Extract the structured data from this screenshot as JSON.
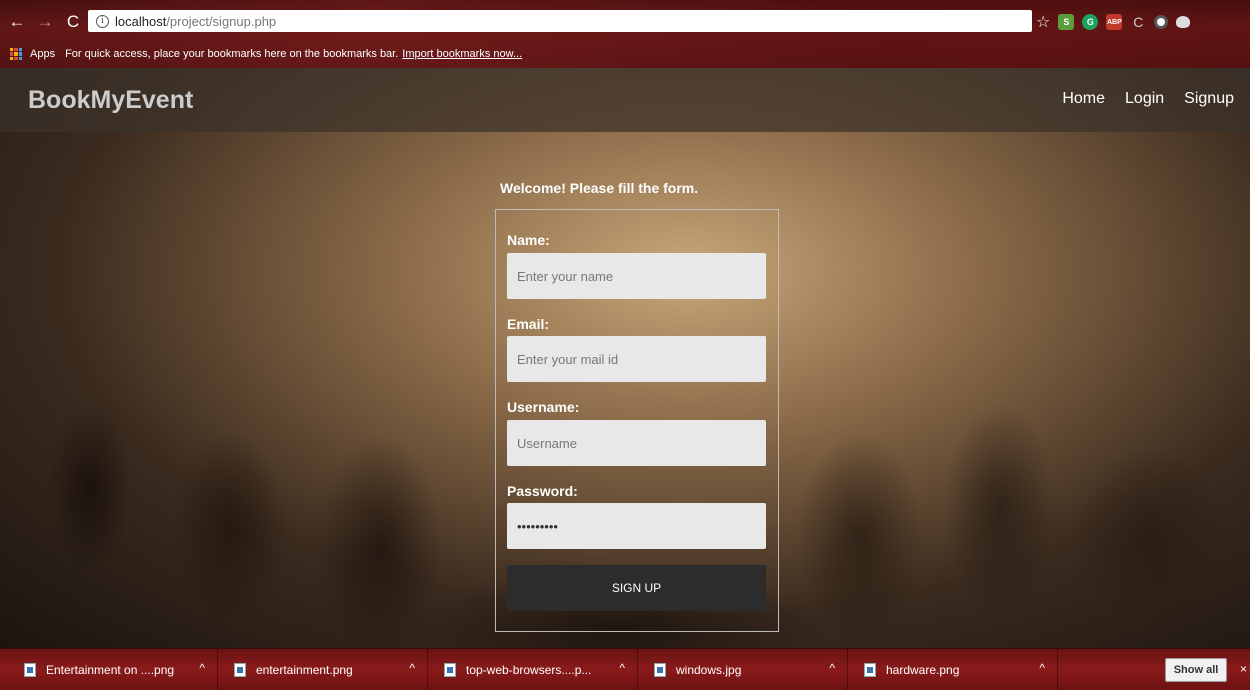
{
  "browser": {
    "url_host": "localhost",
    "url_path": "/project/signup.php",
    "bookmarks_apps": "Apps",
    "bookmarks_hint": "For quick access, place your bookmarks here on the bookmarks bar.",
    "bookmarks_link": "Import bookmarks now...",
    "extensions": [
      "S",
      "G",
      "ABP",
      "C",
      "",
      ""
    ]
  },
  "navbar": {
    "brand": "BookMyEvent",
    "links": [
      "Home",
      "Login",
      "Signup"
    ]
  },
  "form": {
    "welcome": "Welcome! Please fill the form.",
    "fields": [
      {
        "label": "Name:",
        "placeholder": "Enter your name",
        "value": ""
      },
      {
        "label": "Email:",
        "placeholder": "Enter your mail id",
        "value": ""
      },
      {
        "label": "Username:",
        "placeholder": "Username",
        "value": ""
      },
      {
        "label": "Password:",
        "placeholder": "",
        "value": "•••••••••"
      }
    ],
    "submit_label": "SIGN UP"
  },
  "downloads": {
    "items": [
      "Entertainment on ....png",
      "entertainment.png",
      "top-web-browsers....p...",
      "windows.jpg",
      "hardware.png"
    ],
    "show_all": "Show all"
  }
}
